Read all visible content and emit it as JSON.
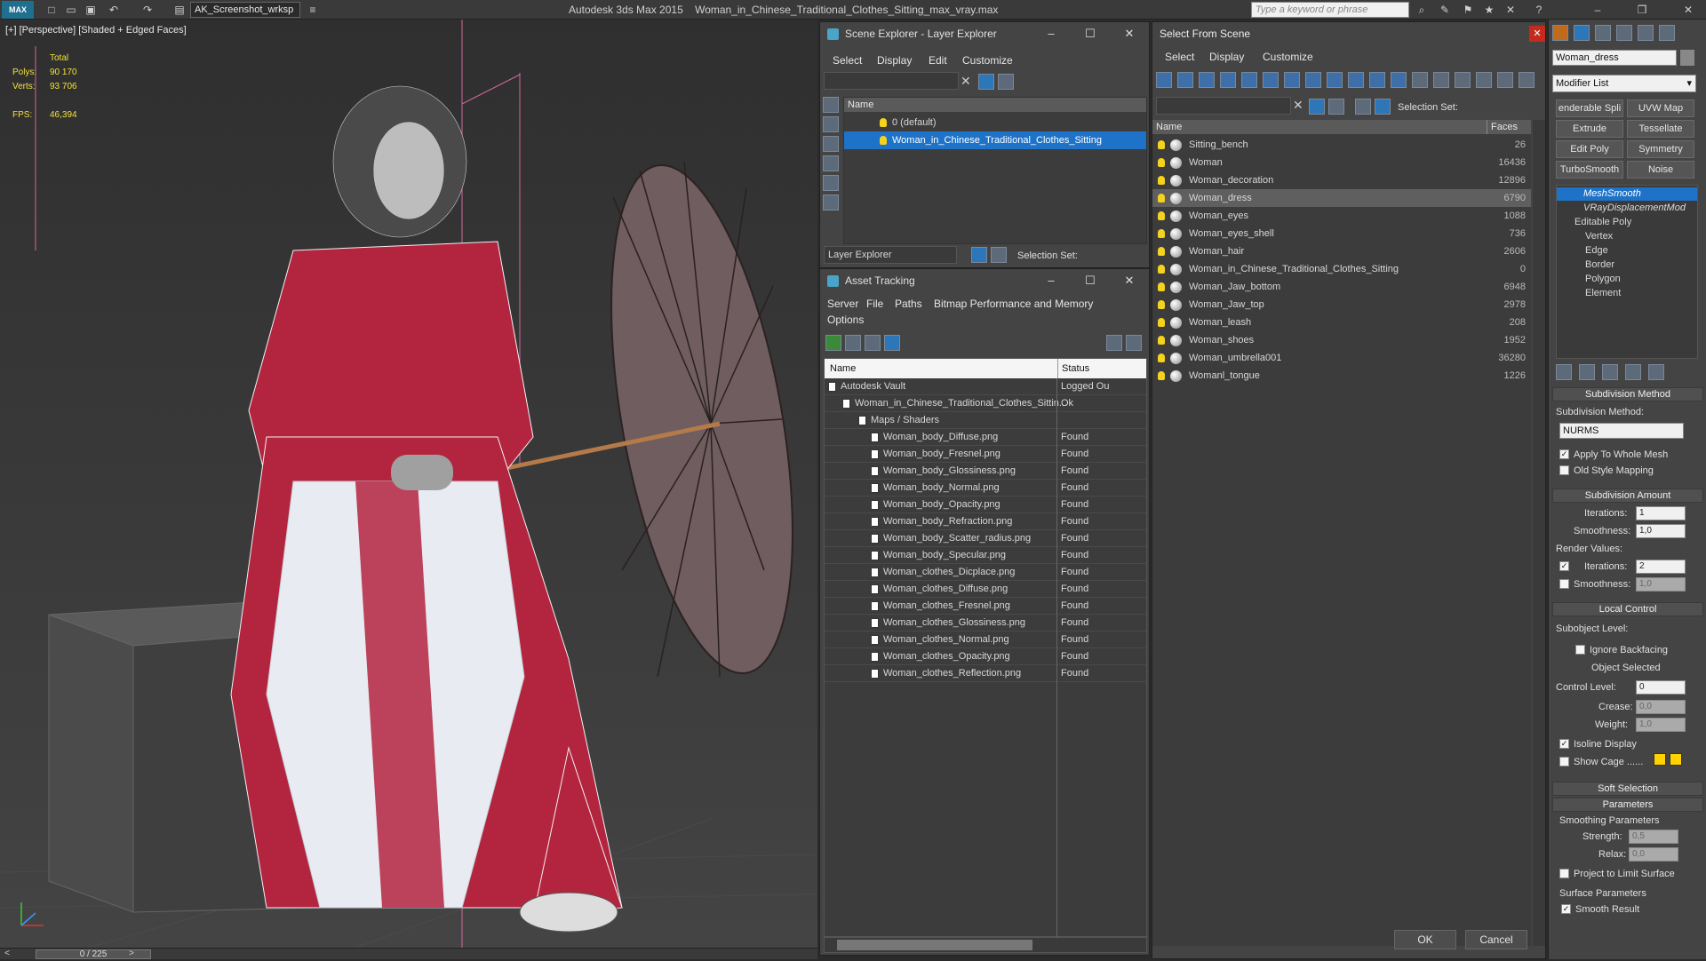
{
  "app": {
    "title": "Autodesk 3ds Max  2015",
    "file": "Woman_in_Chinese_Traditional_Clothes_Sitting_max_vray.max",
    "logo": "MAX",
    "workspace": "AK_Screenshot_wrksp",
    "search_placeholder": "Type a keyword or phrase"
  },
  "viewport": {
    "label": "[+] [Perspective] [Shaded + Edged Faces]",
    "stats": {
      "total_label": "Total",
      "polys_label": "Polys:",
      "polys": "90 170",
      "verts_label": "Verts:",
      "verts": "93 706",
      "fps_label": "FPS:",
      "fps": "46,394"
    },
    "time": "0 / 225"
  },
  "scene_explorer": {
    "title": "Scene Explorer - Layer Explorer",
    "menu": [
      "Select",
      "Display",
      "Edit",
      "Customize"
    ],
    "col_name": "Name",
    "layers": [
      "0 (default)",
      "Woman_in_Chinese_Traditional_Clothes_Sitting"
    ],
    "footer_left": "Layer Explorer",
    "footer_right": "Selection Set:"
  },
  "asset_tracking": {
    "title": "Asset Tracking",
    "menu": [
      "Server",
      "File",
      "Paths",
      "Bitmap Performance and Memory",
      "Options"
    ],
    "col_name": "Name",
    "col_status": "Status",
    "rows": [
      {
        "name": "Autodesk Vault",
        "status": "Logged Ou"
      },
      {
        "name": "Woman_in_Chinese_Traditional_Clothes_Sittin...",
        "status": "Ok"
      },
      {
        "name": "Maps / Shaders",
        "status": ""
      },
      {
        "name": "Woman_body_Diffuse.png",
        "status": "Found"
      },
      {
        "name": "Woman_body_Fresnel.png",
        "status": "Found"
      },
      {
        "name": "Woman_body_Glossiness.png",
        "status": "Found"
      },
      {
        "name": "Woman_body_Normal.png",
        "status": "Found"
      },
      {
        "name": "Woman_body_Opacity.png",
        "status": "Found"
      },
      {
        "name": "Woman_body_Refraction.png",
        "status": "Found"
      },
      {
        "name": "Woman_body_Scatter_radius.png",
        "status": "Found"
      },
      {
        "name": "Woman_body_Specular.png",
        "status": "Found"
      },
      {
        "name": "Woman_clothes_Dicplace.png",
        "status": "Found"
      },
      {
        "name": "Woman_clothes_Diffuse.png",
        "status": "Found"
      },
      {
        "name": "Woman_clothes_Fresnel.png",
        "status": "Found"
      },
      {
        "name": "Woman_clothes_Glossiness.png",
        "status": "Found"
      },
      {
        "name": "Woman_clothes_Normal.png",
        "status": "Found"
      },
      {
        "name": "Woman_clothes_Opacity.png",
        "status": "Found"
      },
      {
        "name": "Woman_clothes_Reflection.png",
        "status": "Found"
      }
    ]
  },
  "select_from_scene": {
    "title": "Select From Scene",
    "menu": [
      "Select",
      "Display",
      "Customize"
    ],
    "selection_set": "Selection Set:",
    "col_name": "Name",
    "col_faces": "Faces",
    "objects": [
      {
        "name": "Sitting_bench",
        "faces": "26"
      },
      {
        "name": "Woman",
        "faces": "16436"
      },
      {
        "name": "Woman_decoration",
        "faces": "12896"
      },
      {
        "name": "Woman_dress",
        "faces": "6790"
      },
      {
        "name": "Woman_eyes",
        "faces": "1088"
      },
      {
        "name": "Woman_eyes_shell",
        "faces": "736"
      },
      {
        "name": "Woman_hair",
        "faces": "2606"
      },
      {
        "name": "Woman_in_Chinese_Traditional_Clothes_Sitting",
        "faces": "0"
      },
      {
        "name": "Woman_Jaw_bottom",
        "faces": "6948"
      },
      {
        "name": "Woman_Jaw_top",
        "faces": "2978"
      },
      {
        "name": "Woman_leash",
        "faces": "208"
      },
      {
        "name": "Woman_shoes",
        "faces": "1952"
      },
      {
        "name": "Woman_umbrella001",
        "faces": "36280"
      },
      {
        "name": "Womanl_tongue",
        "faces": "1226"
      }
    ],
    "ok": "OK",
    "cancel": "Cancel"
  },
  "command_panel": {
    "object_name": "Woman_dress",
    "modifier_list": "Modifier List",
    "buttons": [
      "enderable Spli",
      "UVW Map",
      "Extrude",
      "Tessellate",
      "Edit Poly",
      "Symmetry",
      "TurboSmooth",
      "Noise"
    ],
    "stack": [
      "MeshSmooth",
      "VRayDisplacementMod",
      "Editable Poly",
      "Vertex",
      "Edge",
      "Border",
      "Polygon",
      "Element"
    ],
    "subdivision_method": {
      "header": "Subdivision Method",
      "label": "Subdivision Method:",
      "value": "NURMS",
      "apply_whole_mesh": "Apply To Whole Mesh",
      "old_style_mapping": "Old Style Mapping"
    },
    "subdivision_amount": {
      "header": "Subdivision Amount",
      "iterations_label": "Iterations:",
      "iterations": "1",
      "smoothness_label": "Smoothness:",
      "smoothness": "1,0",
      "render_values": "Render Values:",
      "render_iterations_label": "Iterations:",
      "render_iterations": "2",
      "render_smoothness_label": "Smoothness:",
      "render_smoothness": "1,0"
    },
    "local_control": {
      "header": "Local Control",
      "subobject_level": "Subobject Level:",
      "ignore_backfacing": "Ignore Backfacing",
      "object_selected": "Object Selected",
      "control_level_label": "Control Level:",
      "control_level": "0",
      "crease_label": "Crease:",
      "crease": "0,0",
      "weight_label": "Weight:",
      "weight": "1,0",
      "isoline_display": "Isoline Display",
      "show_cage": "Show Cage ......"
    },
    "soft_selection": "Soft Selection",
    "parameters": {
      "header": "Parameters",
      "smoothing_parameters": "Smoothing Parameters",
      "strength_label": "Strength:",
      "strength": "0,5",
      "relax_label": "Relax:",
      "relax": "0,0",
      "project_limit": "Project to Limit Surface",
      "surface_parameters": "Surface Parameters",
      "smooth_result": "Smooth Result"
    },
    "cage_colors": [
      "#ffd200",
      "#ffd200"
    ]
  },
  "colors": {
    "highlight": "#1e73c8",
    "stats": "#f3e03c"
  }
}
